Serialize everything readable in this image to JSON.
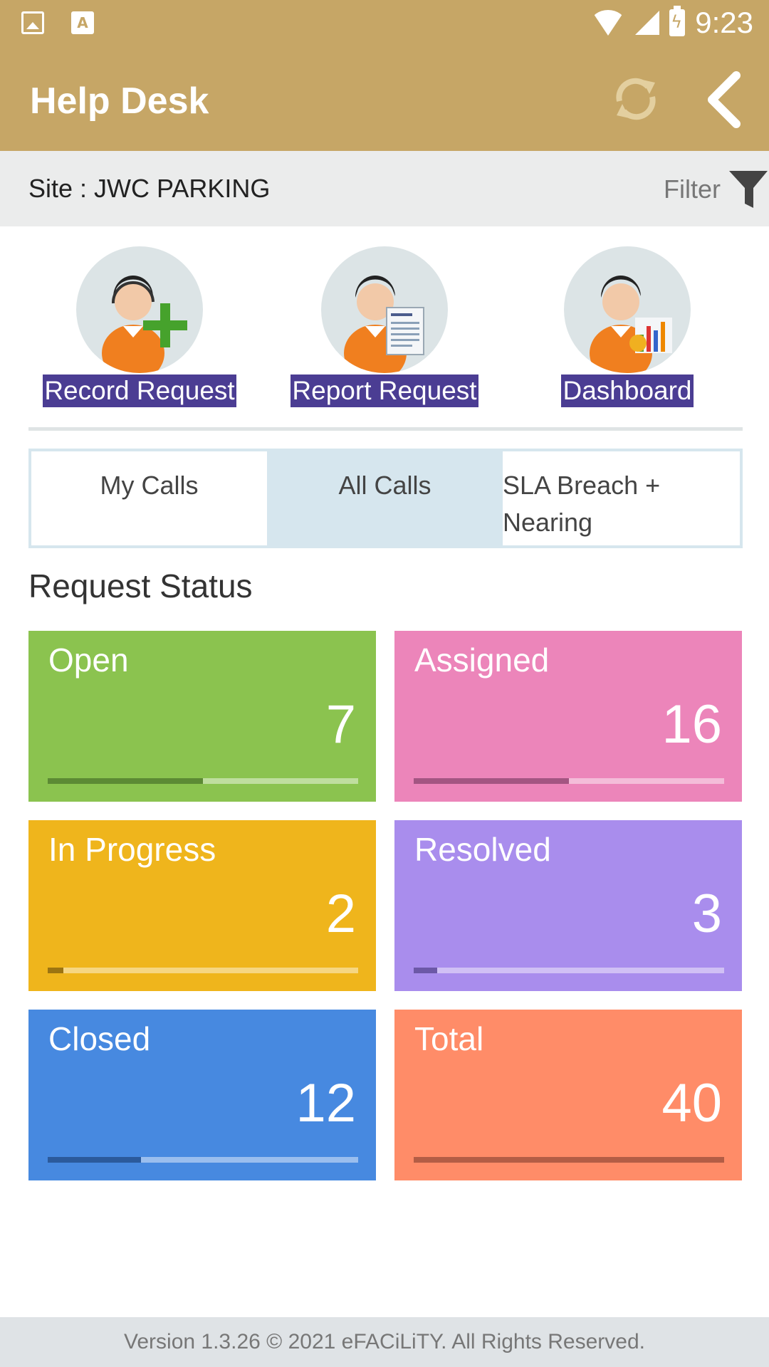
{
  "status_bar": {
    "time": "9:23"
  },
  "app_bar": {
    "title": "Help Desk",
    "refresh_icon": "refresh-icon",
    "back_icon": "chevron-left-icon"
  },
  "site": {
    "label": "Site  : JWC PARKING",
    "filter_label": "Filter"
  },
  "actions": [
    {
      "label": "Record Request",
      "icon": "agent-add-icon"
    },
    {
      "label": "Report Request",
      "icon": "agent-report-icon"
    },
    {
      "label": "Dashboard",
      "icon": "agent-chart-icon"
    }
  ],
  "tabs": [
    {
      "label": "My Calls",
      "active": false
    },
    {
      "label": "All Calls",
      "active": true
    },
    {
      "label": "SLA Breach + Nearing",
      "active": false
    }
  ],
  "section_title": "Request Status",
  "cards": [
    {
      "label": "Open",
      "count": "7",
      "progress": 0.5,
      "bg": "#8bc34f",
      "fill": "#5c8a34"
    },
    {
      "label": "Assigned",
      "count": "16",
      "progress": 0.5,
      "bg": "#ec85ba",
      "fill": "#a35582"
    },
    {
      "label": "In Progress",
      "count": "2",
      "progress": 0.05,
      "bg": "#efb51c",
      "fill": "#9c7411"
    },
    {
      "label": "Resolved",
      "count": "3",
      "progress": 0.075,
      "bg": "#a98ded",
      "fill": "#6c58a7"
    },
    {
      "label": "Closed",
      "count": "12",
      "progress": 0.3,
      "bg": "#4789e0",
      "fill": "#2b5a9c"
    },
    {
      "label": "Total",
      "count": "40",
      "progress": 1.0,
      "bg": "#ff8c68",
      "fill": "#b35d45"
    }
  ],
  "footer": "Version 1.3.26 © 2021 eFACiLiTY. All Rights Reserved."
}
